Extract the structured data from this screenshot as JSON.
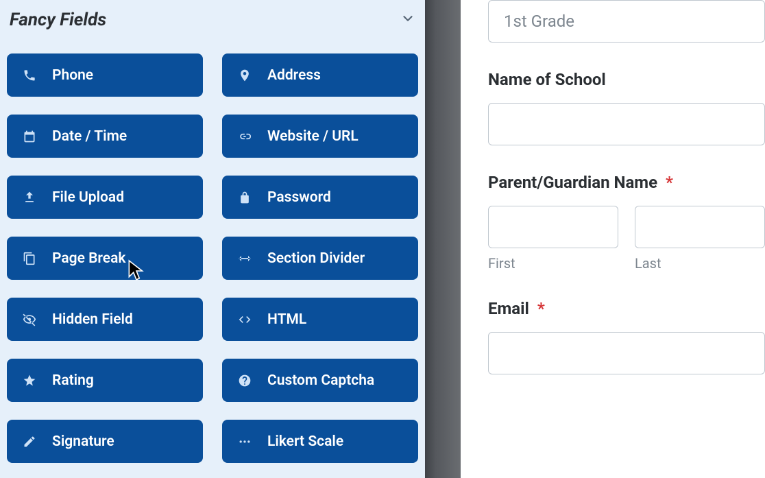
{
  "sidebar": {
    "title": "Fancy Fields",
    "fields": [
      {
        "label": "Phone",
        "icon": "phone"
      },
      {
        "label": "Address",
        "icon": "pin"
      },
      {
        "label": "Date / Time",
        "icon": "calendar"
      },
      {
        "label": "Website / URL",
        "icon": "link"
      },
      {
        "label": "File Upload",
        "icon": "upload"
      },
      {
        "label": "Password",
        "icon": "lock"
      },
      {
        "label": "Page Break",
        "icon": "copy"
      },
      {
        "label": "Section Divider",
        "icon": "divider"
      },
      {
        "label": "Hidden Field",
        "icon": "eyeoff"
      },
      {
        "label": "HTML",
        "icon": "code"
      },
      {
        "label": "Rating",
        "icon": "star"
      },
      {
        "label": "Custom Captcha",
        "icon": "help"
      },
      {
        "label": "Signature",
        "icon": "pencil"
      },
      {
        "label": "Likert Scale",
        "icon": "dots"
      }
    ]
  },
  "preview": {
    "grade_select": {
      "value": "1st Grade"
    },
    "school": {
      "label": "Name of School"
    },
    "parent": {
      "label": "Parent/Guardian Name",
      "required": "*",
      "first_sub": "First",
      "last_sub": "Last"
    },
    "email": {
      "label": "Email",
      "required": "*"
    }
  }
}
